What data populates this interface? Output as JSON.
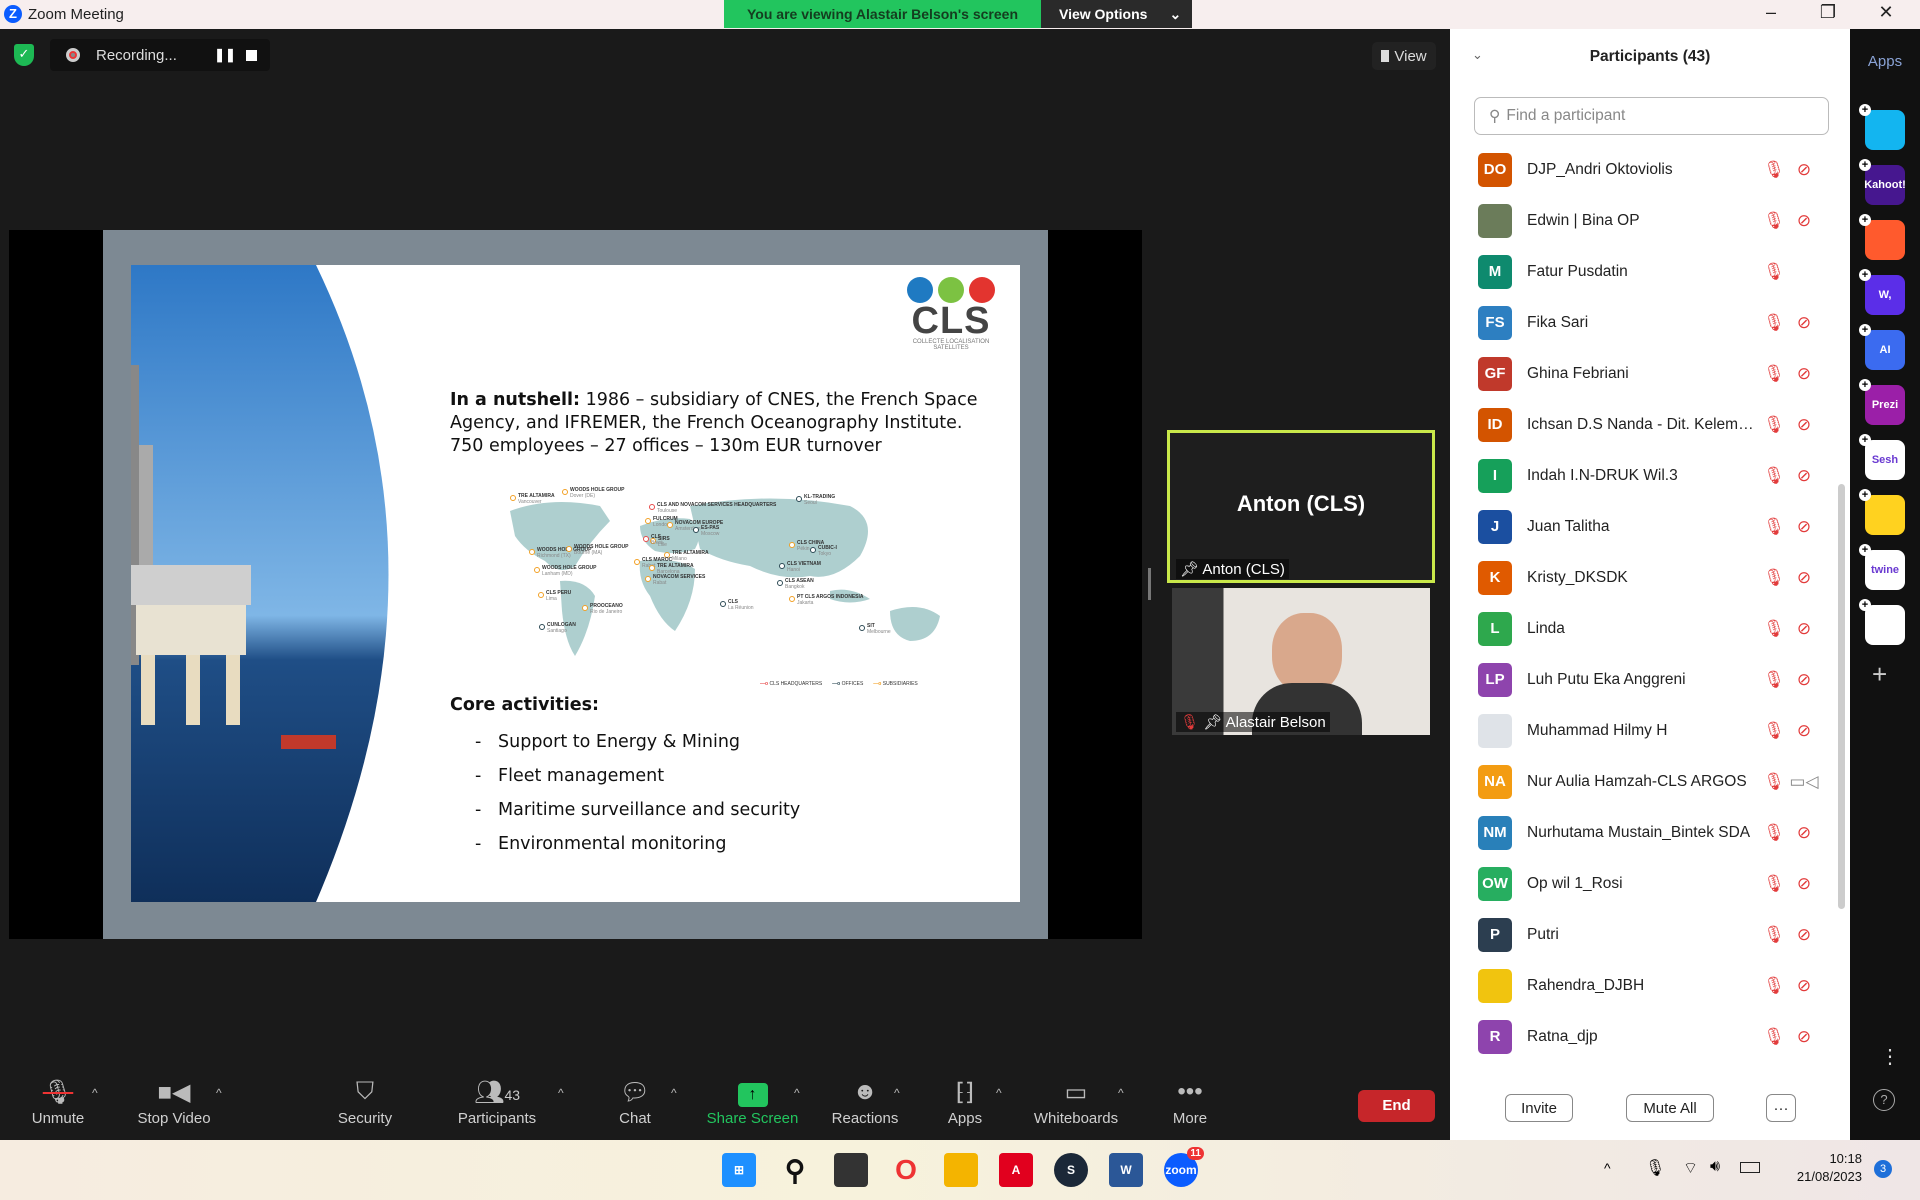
{
  "window": {
    "title": "Zoom Meeting",
    "minimize": "–",
    "restore": "❐",
    "close": "✕"
  },
  "banner": {
    "text": "You are viewing Alastair Belson's screen",
    "view_options": "View Options"
  },
  "recording": {
    "label": "Recording..."
  },
  "view_button": "View",
  "slide": {
    "logo": "CLS",
    "logo_sub": "COLLECTE LOCALISATION SATELLITES",
    "nutshell_bold": "In a nutshell:",
    "nutshell_text": " 1986 – subsidiary of CNES, the French Space Agency, and IFREMER, the French Oceanography Institute.",
    "nutshell_line3": "750 employees – 27 offices – 130m EUR turnover",
    "core_title": "Core activities:",
    "core_items": [
      "Support to Energy & Mining",
      "Fleet management",
      "Maritime surveillance and security",
      "Environmental monitoring"
    ],
    "map_legend": [
      "CLS HEADQUARTERS",
      "OFFICES",
      "SUBSIDIARIES"
    ],
    "map_labels": [
      {
        "name": "TRE ALTAMIRA",
        "city": "Vancouver",
        "type": "subsidiary"
      },
      {
        "name": "WOODS HOLE GROUP",
        "city": "Dover (DE)",
        "type": "subsidiary"
      },
      {
        "name": "CLS AND NOVACOM SERVICES HEADQUARTERS",
        "city": "Toulouse",
        "type": "hq"
      },
      {
        "name": "KL-TRADING",
        "city": "Seoul",
        "type": "office"
      },
      {
        "name": "FULCRUM",
        "city": "London",
        "type": "subsidiary"
      },
      {
        "name": "NOVACOM EUROPE",
        "city": "Amsterdam",
        "type": "subsidiary"
      },
      {
        "name": "ES-PAS",
        "city": "Moscow",
        "type": "office"
      },
      {
        "name": "SIRS",
        "city": "Lille",
        "type": "subsidiary"
      },
      {
        "name": "CLS",
        "city": "Brest",
        "type": "hq"
      },
      {
        "name": "CLS CHINA",
        "city": "Pékin",
        "type": "subsidiary"
      },
      {
        "name": "CUBIC-I",
        "city": "Tokyo",
        "type": "office"
      },
      {
        "name": "WOODS HOLE GROUP",
        "city": "Richmond (TX)",
        "type": "subsidiary"
      },
      {
        "name": "WOODS HOLE GROUP",
        "city": "Bourne (MA)",
        "type": "subsidiary"
      },
      {
        "name": "TRE ALTAMIRA",
        "city": "Milano",
        "type": "subsidiary"
      },
      {
        "name": "CLS MAROC",
        "city": "Rabat",
        "type": "subsidiary"
      },
      {
        "name": "CLS VIETNAM",
        "city": "Hanoi",
        "type": "office"
      },
      {
        "name": "WOODS HOLE GROUP",
        "city": "Lanham (MD)",
        "type": "subsidiary"
      },
      {
        "name": "TRE ALTAMIRA",
        "city": "Barcelona",
        "type": "subsidiary"
      },
      {
        "name": "NOVACOM SERVICES",
        "city": "Rabat",
        "type": "subsidiary"
      },
      {
        "name": "CLS ASEAN",
        "city": "Bangkok",
        "type": "office"
      },
      {
        "name": "CLS PERU",
        "city": "Lima",
        "type": "subsidiary"
      },
      {
        "name": "PROOCEANO",
        "city": "Rio de Janeiro",
        "type": "subsidiary"
      },
      {
        "name": "CLS",
        "city": "La Réunion",
        "type": "office"
      },
      {
        "name": "PT CLS ARGOS INDONESIA",
        "city": "Jakarta",
        "type": "subsidiary"
      },
      {
        "name": "CUNLOGAN",
        "city": "Santiago",
        "type": "office"
      },
      {
        "name": "SIT",
        "city": "Melbourne",
        "type": "office"
      }
    ]
  },
  "videos": [
    {
      "name": "Anton (CLS)",
      "display": "Anton (CLS)",
      "active_speaker": true
    },
    {
      "name": "Alastair Belson",
      "muted": true
    }
  ],
  "participants_panel": {
    "title": "Participants (43)",
    "search_placeholder": "Find a participant",
    "participants": [
      {
        "name": "DJP_Andri Oktoviolis",
        "initials": "DO",
        "color": "#d35400",
        "video_off": true
      },
      {
        "name": "Edwin | Bina OP",
        "initials": "",
        "color": "#6b7c5a",
        "video_off": true
      },
      {
        "name": "Fatur Pusdatin",
        "initials": "M",
        "color": "#0e8a6e",
        "video_off": false
      },
      {
        "name": "Fika Sari",
        "initials": "FS",
        "color": "#2d7fc1",
        "video_off": true
      },
      {
        "name": "Ghina Febriani",
        "initials": "GF",
        "color": "#c0392b",
        "video_off": true
      },
      {
        "name": "Ichsan D.S Nanda - Dit. Kelemba...",
        "initials": "ID",
        "color": "#d35400",
        "video_off": true
      },
      {
        "name": "Indah I.N-DRUK Wil.3",
        "initials": "I",
        "color": "#16a05a",
        "video_off": true
      },
      {
        "name": "Juan Talitha",
        "initials": "J",
        "color": "#1b4fa0",
        "video_off": true
      },
      {
        "name": "Kristy_DKSDK",
        "initials": "K",
        "color": "#e05a00",
        "video_off": true
      },
      {
        "name": "Linda",
        "initials": "L",
        "color": "#2ea84d",
        "video_off": true
      },
      {
        "name": "Luh Putu Eka Anggreni",
        "initials": "LP",
        "color": "#8e44ad",
        "video_off": true
      },
      {
        "name": "Muhammad Hilmy H",
        "initials": "",
        "color": "#dfe3e8",
        "video_off": true
      },
      {
        "name": "Nur Aulia Hamzah-CLS ARGOS",
        "initials": "NA",
        "color": "#f39c12",
        "video_off": false,
        "video_on": true
      },
      {
        "name": "Nurhutama Mustain_Bintek SDA",
        "initials": "NM",
        "color": "#2980b9",
        "video_off": true
      },
      {
        "name": "Op wil 1_Rosi",
        "initials": "OW",
        "color": "#27ae60",
        "video_off": true
      },
      {
        "name": "Putri",
        "initials": "P",
        "color": "#2c3e50",
        "video_off": true
      },
      {
        "name": "Rahendra_DJBH",
        "initials": "",
        "color": "#f1c40f",
        "video_off": true
      },
      {
        "name": "Ratna_djp",
        "initials": "R",
        "color": "#8e44ad",
        "video_off": true
      }
    ],
    "invite": "Invite",
    "mute_all": "Mute All",
    "more": "···"
  },
  "apps_strip": {
    "title": "Apps",
    "apps": [
      {
        "name": "",
        "color": "#13b5f0",
        "icon": "paper-plane"
      },
      {
        "name": "Kahoot!",
        "color": "#46178f"
      },
      {
        "name": "",
        "color": "#ff5a2d",
        "icon": "c-block"
      },
      {
        "name": "W,",
        "color": "#5b2ee8"
      },
      {
        "name": "AI",
        "color": "#3b6bf0"
      },
      {
        "name": "Prezi",
        "color": "#9b1fa8"
      },
      {
        "name": "Sesh",
        "color": "#ffffff"
      },
      {
        "name": "",
        "color": "#ffd21f",
        "icon": "emoji"
      },
      {
        "name": "twine",
        "color": "#ffffff"
      },
      {
        "name": "",
        "color": "#ffffff",
        "icon": "grid"
      }
    ]
  },
  "toolbar": {
    "unmute": "Unmute",
    "stop_video": "Stop Video",
    "security": "Security",
    "participants": "Participants",
    "participants_count": "43",
    "chat": "Chat",
    "share_screen": "Share Screen",
    "reactions": "Reactions",
    "apps": "Apps",
    "whiteboards": "Whiteboards",
    "more": "More",
    "end": "End"
  },
  "taskbar": {
    "zoom_badge": "11",
    "time": "10:18",
    "date": "21/08/2023",
    "notifications": "3"
  }
}
